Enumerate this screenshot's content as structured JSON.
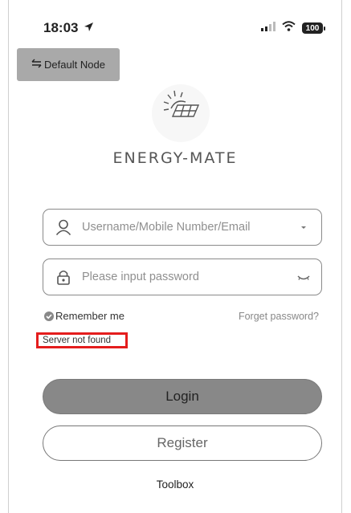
{
  "status_bar": {
    "time": "18:03",
    "battery": "100"
  },
  "node_button": {
    "label": "Default Node"
  },
  "brand": {
    "name": "ENERGY-MATE"
  },
  "login_form": {
    "username_placeholder": "Username/Mobile Number/Email",
    "password_placeholder": "Please input password",
    "remember_label": "Remember me",
    "forget_label": "Forget password?",
    "error_message": "Server not found"
  },
  "actions": {
    "login_label": "Login",
    "register_label": "Register",
    "toolbox_label": "Toolbox"
  },
  "colors": {
    "error_highlight": "#e41d1d",
    "login_button": "#888888",
    "node_button": "#a9a9a9"
  }
}
